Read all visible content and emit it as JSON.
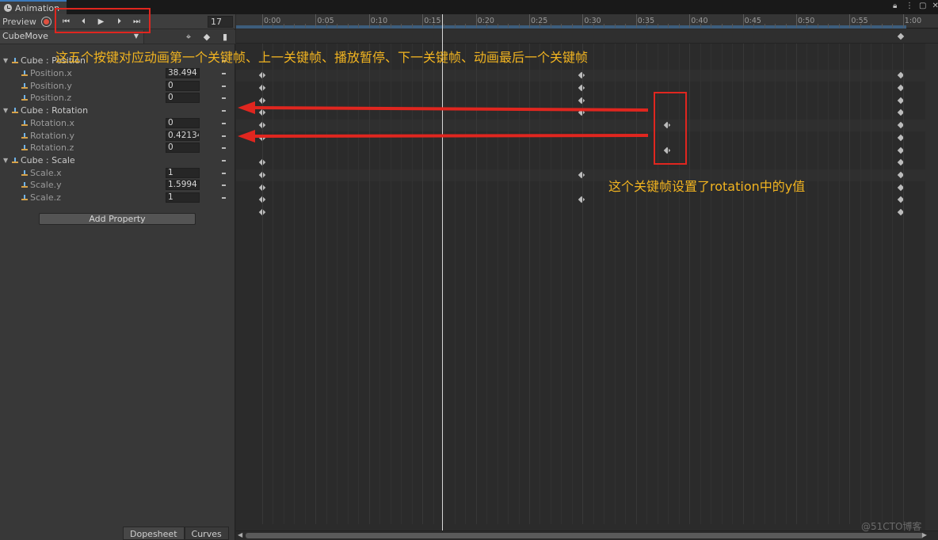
{
  "window": {
    "tab_title": "Animation",
    "controls": [
      "lock-icon",
      "menu-icon",
      "maximize-icon",
      "close-icon"
    ]
  },
  "toolbar": {
    "preview_label": "Preview",
    "record_icon": "record-icon",
    "transport": [
      "first-keyframe-icon",
      "previous-keyframe-icon",
      "play-icon",
      "next-keyframe-icon",
      "last-keyframe-icon"
    ],
    "frame_value": "17",
    "clip_name": "CubeMove",
    "tools": [
      "filter-icon",
      "add-keyframe-icon",
      "add-event-icon"
    ]
  },
  "properties": [
    {
      "type": "group",
      "label": "Cube : Position",
      "value": ""
    },
    {
      "type": "child",
      "label": "Position.x",
      "value": "38.494"
    },
    {
      "type": "child",
      "label": "Position.y",
      "value": "0"
    },
    {
      "type": "child",
      "label": "Position.z",
      "value": "0"
    },
    {
      "type": "group",
      "label": "Cube : Rotation",
      "value": ""
    },
    {
      "type": "child",
      "label": "Rotation.x",
      "value": "0"
    },
    {
      "type": "child",
      "label": "Rotation.y",
      "value": "0.42134"
    },
    {
      "type": "child",
      "label": "Rotation.z",
      "value": "0"
    },
    {
      "type": "group",
      "label": "Cube : Scale",
      "value": ""
    },
    {
      "type": "child",
      "label": "Scale.x",
      "value": "1"
    },
    {
      "type": "child",
      "label": "Scale.y",
      "value": "1.5994"
    },
    {
      "type": "child",
      "label": "Scale.z",
      "value": "1"
    }
  ],
  "add_property_label": "Add Property",
  "bottom_tabs": [
    "Dopesheet",
    "Curves"
  ],
  "timeline": {
    "ruler_labels": [
      "0:00",
      "0:05",
      "0:10",
      "0:15",
      "0:20",
      "0:25",
      "0:30",
      "0:35",
      "0:40",
      "0:45",
      "0:50",
      "0:55",
      "1:00"
    ],
    "playhead_time": "0:17"
  },
  "annotations": {
    "top_note": "这五个按键对应动画第一个关键帧、上一关键帧、播放暂停、下一关键帧、动画最后一个关键帧",
    "right_note": "这个关键帧设置了rotation中的y值",
    "annotation_color": "#e0261f",
    "text_color": "#f2b420"
  },
  "watermark": "@51CTO博客"
}
